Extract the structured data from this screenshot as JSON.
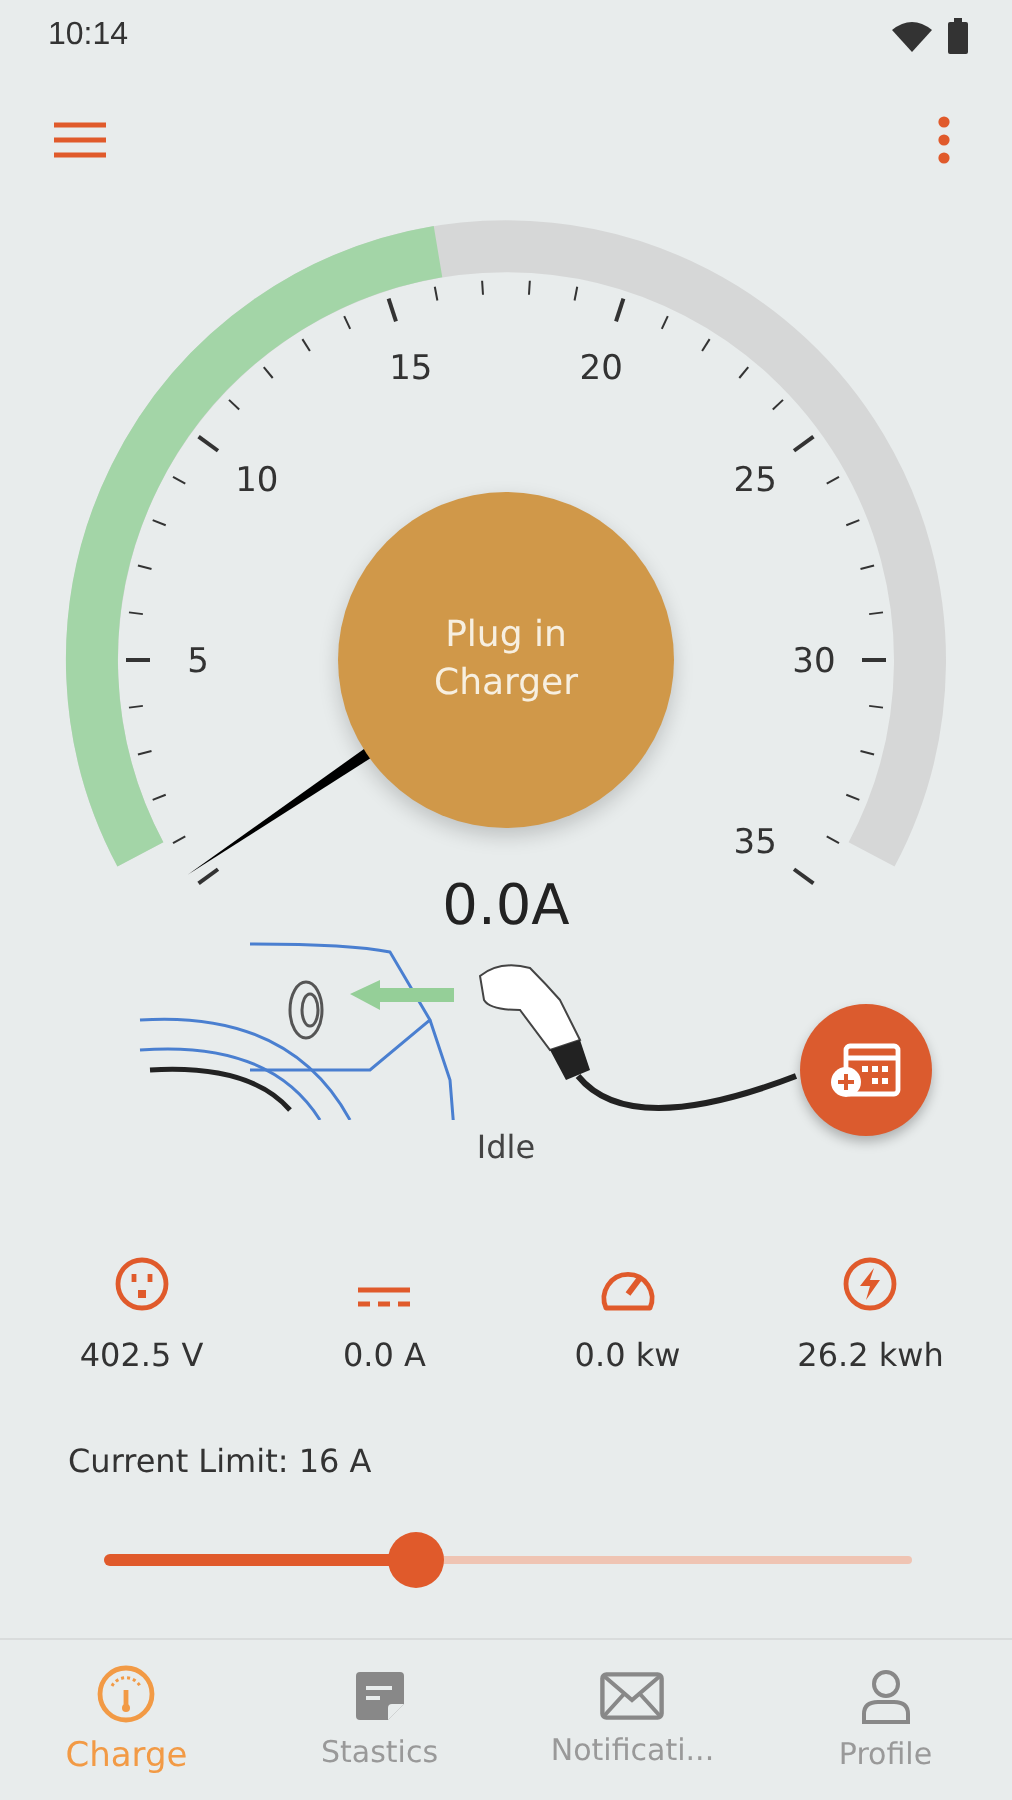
{
  "status_bar": {
    "time": "10:14"
  },
  "gauge": {
    "labels": [
      "5",
      "10",
      "15",
      "20",
      "25",
      "30",
      "35"
    ],
    "button": "Plug in Charger",
    "reading": "0.0A"
  },
  "charging_status": "Idle",
  "stats": [
    {
      "kind": "voltage",
      "value": "402.5 V"
    },
    {
      "kind": "current",
      "value": "0.0 A"
    },
    {
      "kind": "power",
      "value": "0.0 kw"
    },
    {
      "kind": "energy",
      "value": "26.2 kwh"
    }
  ],
  "current_limit": {
    "label": "Current Limit: 16 A",
    "level": 0.385
  },
  "bottom_nav": [
    {
      "kind": "charge",
      "label": "Charge",
      "selected": true
    },
    {
      "kind": "stats",
      "label": "Stastics",
      "selected": false
    },
    {
      "kind": "mail",
      "label": "Notificati...",
      "selected": false
    },
    {
      "kind": "profile",
      "label": "Profile",
      "selected": false
    }
  ]
}
